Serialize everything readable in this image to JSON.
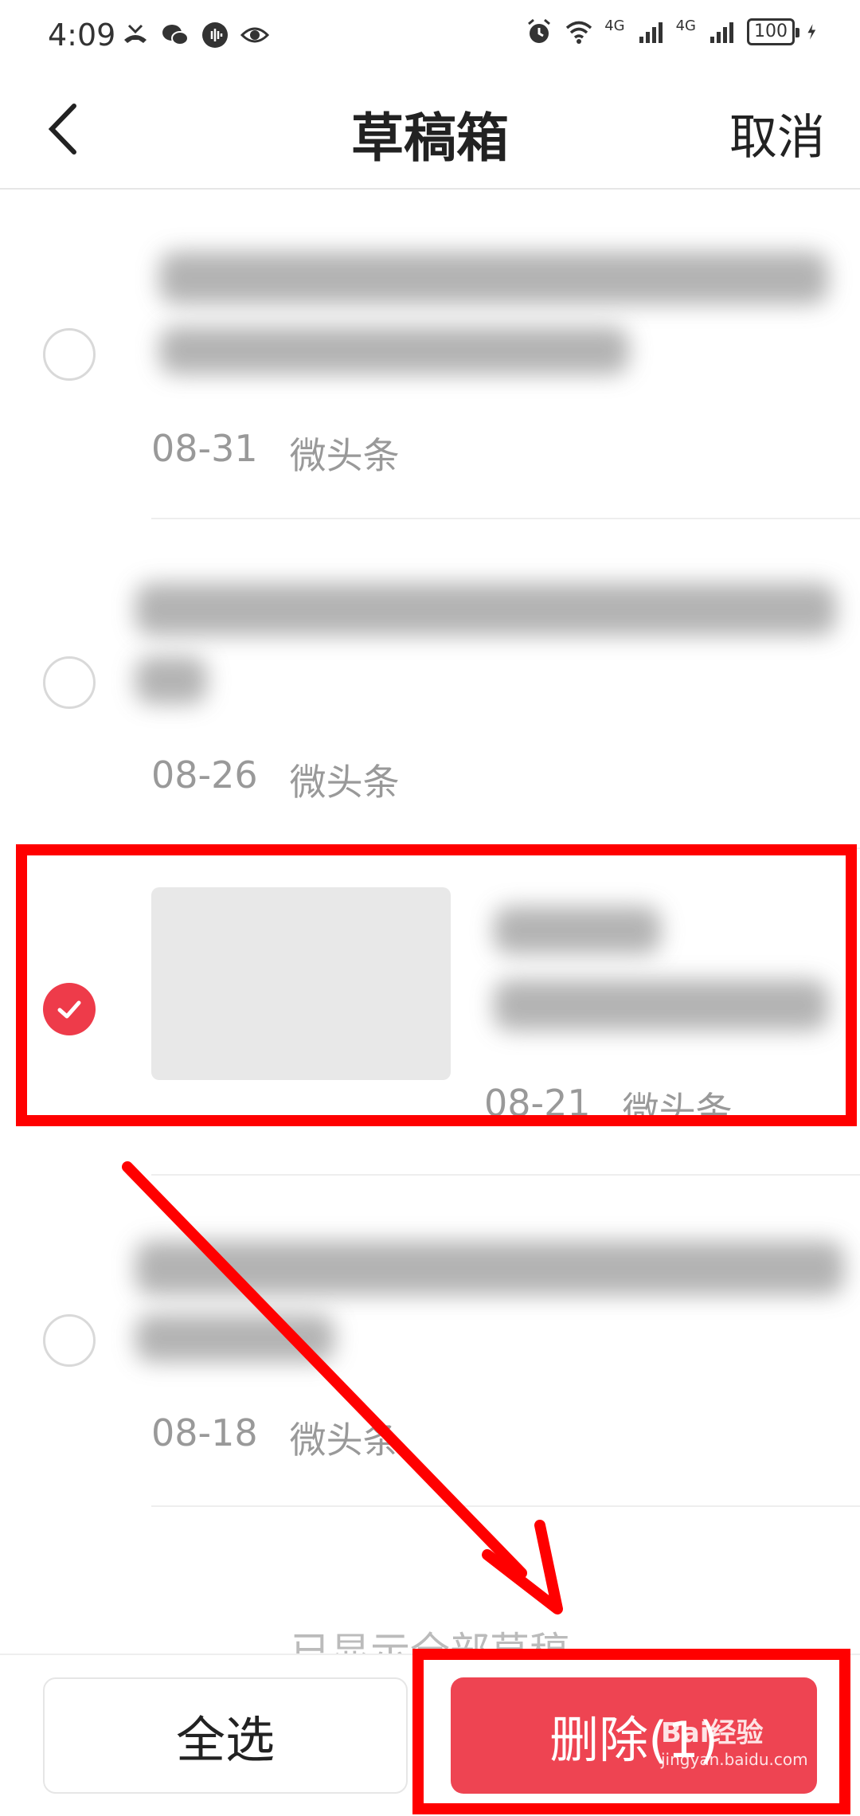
{
  "status_bar": {
    "time": "4:09",
    "network_1": "4G",
    "network_2": "4G",
    "battery": "100",
    "icons": [
      "missed-call-icon",
      "wechat-icon",
      "audio-icon",
      "eye-icon",
      "alarm-icon",
      "wifi-icon",
      "signal-icon",
      "signal-icon",
      "battery-icon",
      "charging-icon"
    ]
  },
  "header": {
    "title": "草稿箱",
    "cancel_label": "取消"
  },
  "drafts": [
    {
      "date": "08-31",
      "source": "微头条",
      "selected": false
    },
    {
      "date": "08-26",
      "source": "微头条",
      "selected": false
    },
    {
      "date": "08-21",
      "source": "微头条",
      "selected": true
    },
    {
      "date": "08-18",
      "source": "微头条",
      "selected": false
    }
  ],
  "footer_note": "已显示全部草稿",
  "bottom_bar": {
    "select_all_label": "全选",
    "delete_label": "删除(1)"
  },
  "colors": {
    "accent": "#ee4452",
    "annotation": "#ff0000"
  },
  "watermark": {
    "brand": "Bai",
    "brand_2": "经验",
    "site": "jingyan.baidu.com"
  }
}
